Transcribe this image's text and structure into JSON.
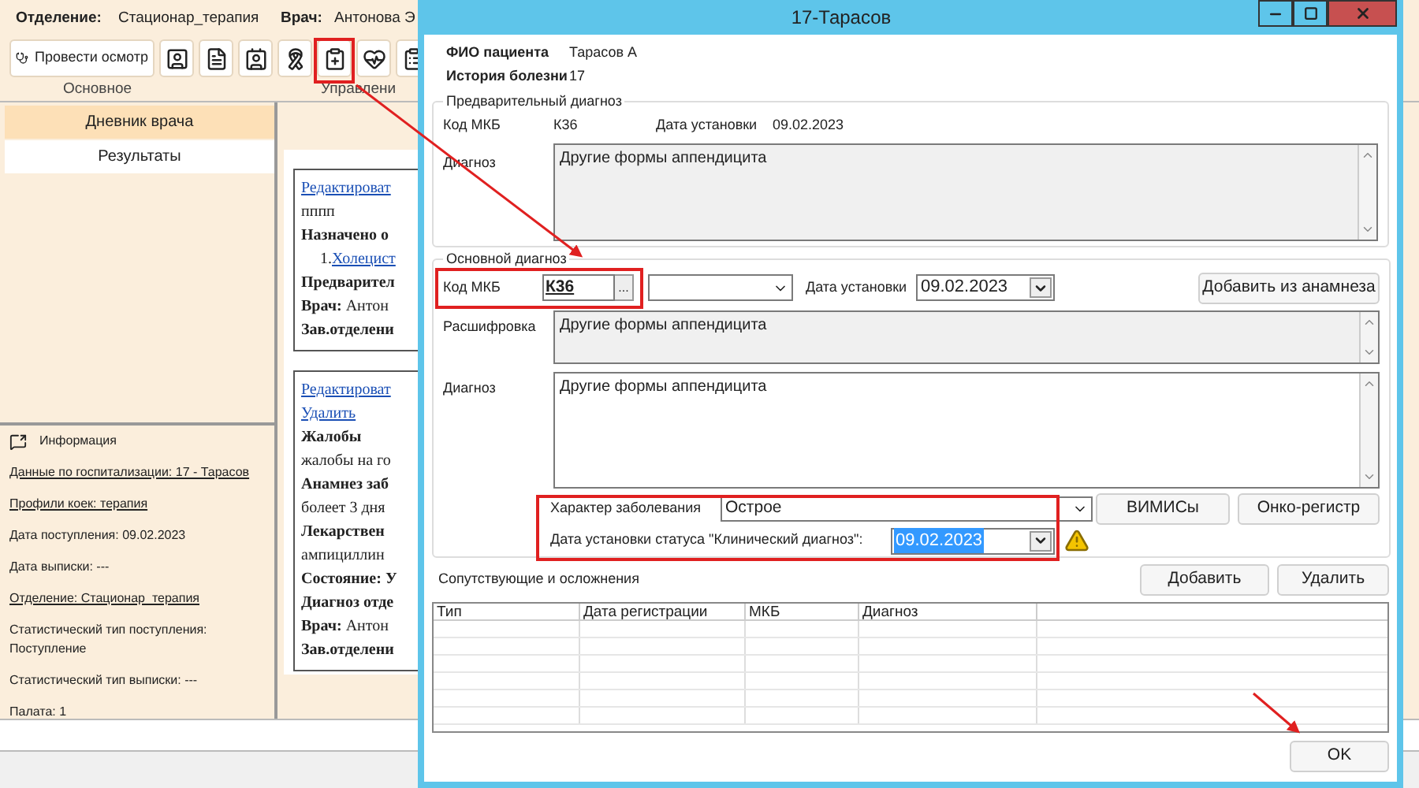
{
  "app": {
    "header": [
      {
        "label": "Отделение:",
        "value": "Стационар_терапия"
      },
      {
        "label": "Врач:",
        "value": "Антонова Э"
      }
    ],
    "exam_button": "Провести осмотр",
    "toolbar_groups": [
      "Основное",
      "Управлени"
    ],
    "tabs": [
      {
        "label": "Дневник врача",
        "selected": true
      },
      {
        "label": "Результаты",
        "selected": false
      }
    ],
    "info": {
      "title": "Информация",
      "items": [
        {
          "text": "Данные по госпитализации: 17 - Тарасов",
          "link": true
        },
        {
          "text": "Профили коек: терапия",
          "link": true
        },
        {
          "text": "Дата поступления: 09.02.2023",
          "link": false
        },
        {
          "text": "Дата выписки: ---",
          "link": false
        },
        {
          "text": "Отделение: Стационар_терапия",
          "link": true
        },
        {
          "text": "Статистический тип поступления: Поступление",
          "link": false
        },
        {
          "text": "Статистический тип выписки: ---",
          "link": false
        },
        {
          "text": "Палата: 1",
          "link": false
        }
      ]
    },
    "journal": [
      {
        "entries": [
          {
            "kind": "link",
            "text": "Редактироват"
          },
          {
            "kind": "plain",
            "text": "пппп"
          },
          {
            "kind": "bold",
            "text": "Назначено о"
          },
          {
            "kind": "list_link",
            "number": "1.",
            "text": "Холецист"
          },
          {
            "kind": "bold",
            "text": "Предварител"
          },
          {
            "kind": "plain",
            "text": "**Врач:** Антон"
          },
          {
            "kind": "bold",
            "text": "Зав.отделени"
          }
        ]
      },
      {
        "entries": [
          {
            "kind": "link",
            "text": "Редактироват"
          },
          {
            "kind": "link",
            "text": "Удалить"
          },
          {
            "kind": "bold",
            "text": "Жалобы"
          },
          {
            "kind": "plain",
            "text": "жалобы на го"
          },
          {
            "kind": "bold",
            "text": "Анамнез заб"
          },
          {
            "kind": "plain",
            "text": "болеет 3 дня"
          },
          {
            "kind": "bold",
            "text": "Лекарствен"
          },
          {
            "kind": "plain",
            "text": "ампициллин"
          },
          {
            "kind": "bold",
            "text": "Состояние: У"
          },
          {
            "kind": "bold",
            "text": "Диагноз отде"
          },
          {
            "kind": "plain",
            "text": "**Врач:** Антон"
          },
          {
            "kind": "bold",
            "text": "Зав.отделени"
          }
        ]
      }
    ]
  },
  "dialog": {
    "title": "17-Тарасов",
    "patient": [
      {
        "label": "ФИО пациента",
        "value": "Тарасов А"
      },
      {
        "label": "История болезни",
        "value": "17"
      }
    ],
    "preliminary": {
      "title": "Предварительный диагноз",
      "code_label": "Код МКБ",
      "code": "К36",
      "date_label": "Дата установки",
      "date": "09.02.2023",
      "diagnosis_label": "Диагноз",
      "diagnosis": "Другие формы аппендицита"
    },
    "main": {
      "title": "Основной диагноз",
      "code_label": "Код МКБ",
      "code": "К36",
      "browse": "...",
      "date_label": "Дата установки",
      "date": "09.02.2023",
      "add_button": "Добавить из анамнеза",
      "decode_label": "Расшифровка",
      "decode": "Другие формы аппендицита",
      "diagnosis_label": "Диагноз",
      "diagnosis": "Другие формы аппендицита",
      "nature_label": "Характер заболевания",
      "nature": "Острое",
      "buttons": [
        "ВИМИСы",
        "Онко-регистр"
      ],
      "status_date_label": "Дата установки статуса \"Клинический диагноз\":",
      "status_date": "09.02.2023",
      "status_date_selected": true
    },
    "comorbid": {
      "title": "Сопутствующие и осложнения",
      "buttons": [
        "Добавить",
        "Удалить"
      ],
      "columns": [
        "Тип",
        "Дата регистрации",
        "МКБ",
        "Диагноз"
      ]
    },
    "ok": "OK"
  }
}
